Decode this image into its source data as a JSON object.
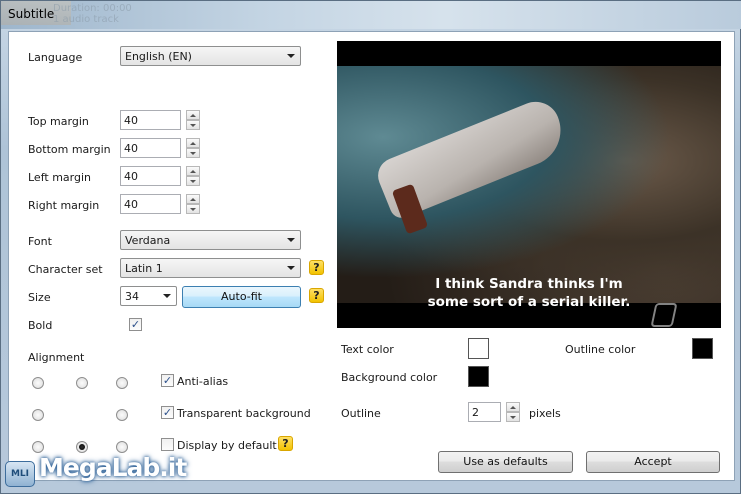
{
  "window": {
    "title": "Subtitle",
    "background_ghost": [
      "Duration: 00:00",
      "1 audio track"
    ]
  },
  "form": {
    "language": {
      "label": "Language",
      "value": "English (EN)"
    },
    "margins": [
      {
        "label": "Top margin",
        "value": "40"
      },
      {
        "label": "Bottom margin",
        "value": "40"
      },
      {
        "label": "Left margin",
        "value": "40"
      },
      {
        "label": "Right margin",
        "value": "40"
      }
    ],
    "font": {
      "label": "Font",
      "value": "Verdana"
    },
    "charset": {
      "label": "Character set",
      "value": "Latin 1"
    },
    "size": {
      "label": "Size",
      "value": "34",
      "autofit_label": "Auto-fit"
    },
    "bold": {
      "label": "Bold",
      "checked": true
    },
    "alignment": {
      "label": "Alignment",
      "selected": "bottom-center"
    },
    "options": {
      "anti_alias": {
        "label": "Anti-alias",
        "checked": true
      },
      "transparent_bg": {
        "label": "Transparent background",
        "checked": true
      },
      "display_default": {
        "label": "Display by default",
        "checked": false
      }
    }
  },
  "preview": {
    "subtitle_line1": "I think Sandra thinks I'm",
    "subtitle_line2": "some sort of a serial killer."
  },
  "colors": {
    "text_color": {
      "label": "Text color",
      "value": "#ffffff"
    },
    "outline_color": {
      "label": "Outline color",
      "value": "#000000"
    },
    "background_color": {
      "label": "Background color",
      "value": "#000000"
    },
    "outline": {
      "label": "Outline",
      "value": "2",
      "unit": "pixels"
    }
  },
  "buttons": {
    "use_defaults": "Use as defaults",
    "accept": "Accept"
  },
  "help_glyph": "?",
  "checkmark_glyph": "✓",
  "watermark": {
    "text": "MegaLab.it",
    "icon_text": "MLI"
  }
}
